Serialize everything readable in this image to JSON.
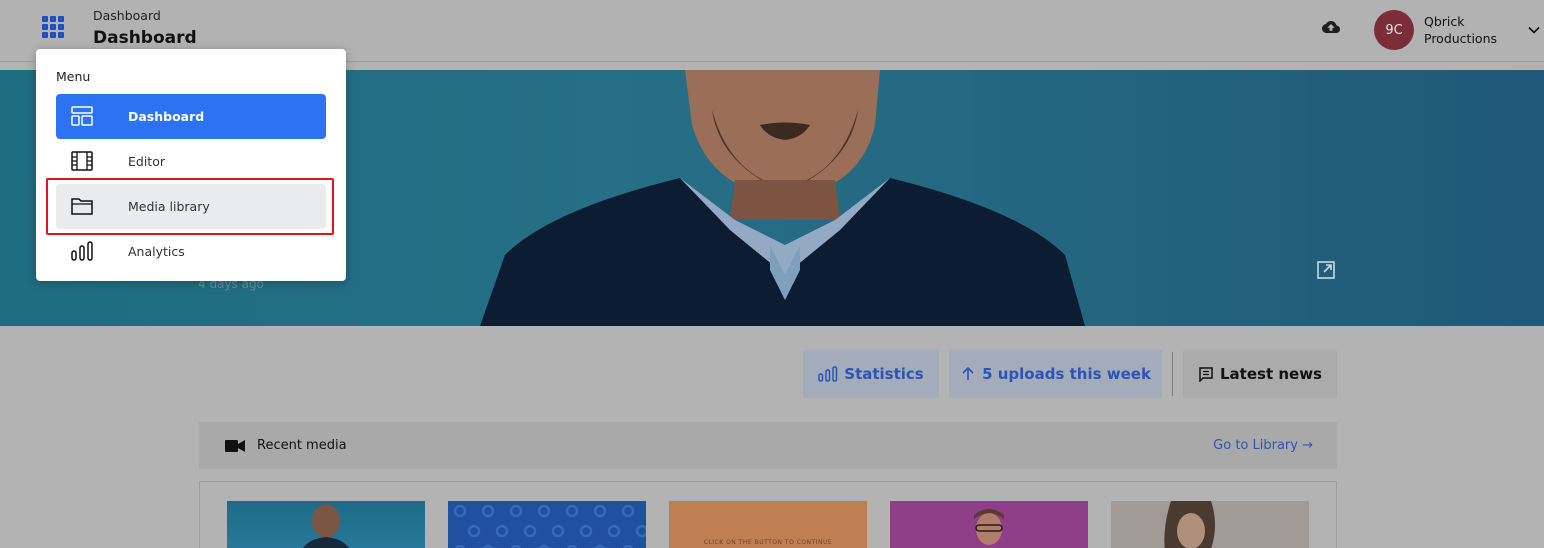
{
  "header": {
    "breadcrumb": "Dashboard",
    "title": "Dashboard",
    "avatar_initials": "9C",
    "organization": "Qbrick Productions",
    "brand_blue": "#1f4fbf",
    "avatar_color": "#7b2e3a"
  },
  "hero": {
    "time_ago": "4 days ago"
  },
  "actions": {
    "statistics": "Statistics",
    "uploads": "5 uploads this week",
    "news": "Latest news"
  },
  "recent": {
    "label": "Recent media",
    "go_to_library": "Go to Library →",
    "thumb_caption": "CLICK ON THE BUTTON TO CONTINUE"
  },
  "menu": {
    "title": "Menu",
    "items": [
      {
        "label": "Dashboard",
        "icon": "dashboard-icon",
        "active": true
      },
      {
        "label": "Editor",
        "icon": "film-icon",
        "active": false
      },
      {
        "label": "Media library",
        "icon": "folder-icon",
        "active": false,
        "highlighted": true
      },
      {
        "label": "Analytics",
        "icon": "bar-chart-icon",
        "active": false
      }
    ],
    "active_color": "#2b73f3",
    "highlight_color": "#e3161b"
  }
}
